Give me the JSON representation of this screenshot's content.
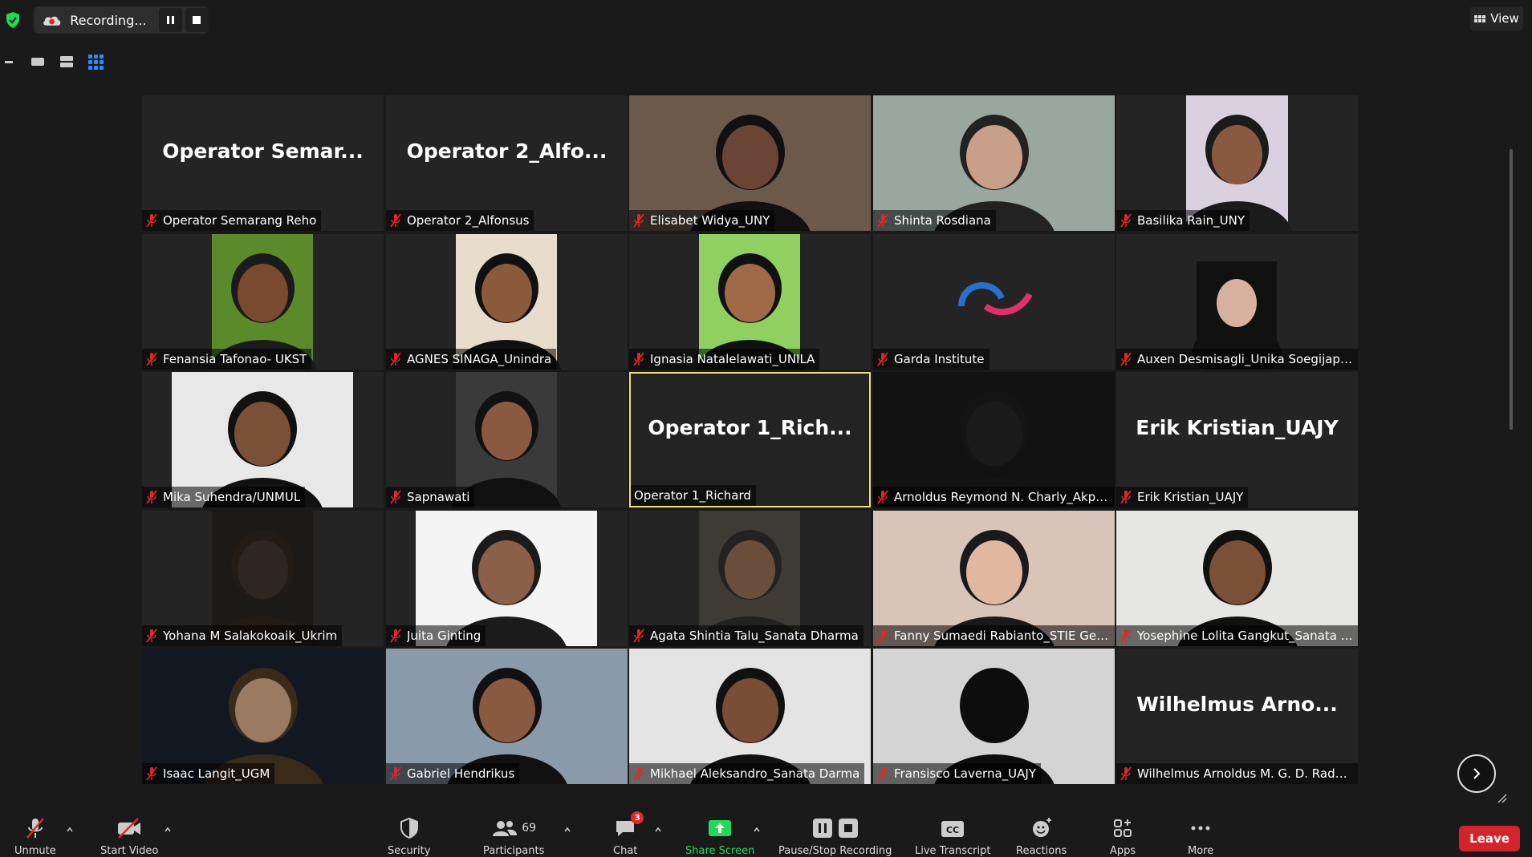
{
  "top": {
    "recording_label": "Recording...",
    "view_label": "View"
  },
  "participants_grid": [
    {
      "name": "Operator Semarang Reho",
      "big_name": "Operator  Semar...",
      "has_video": false,
      "muted": true
    },
    {
      "name": "Operator 2_Alfonsus",
      "big_name": "Operator  2_Alfo...",
      "has_video": false,
      "muted": true
    },
    {
      "name": "Elisabet Widya_UNY",
      "has_video": true,
      "muted": true
    },
    {
      "name": "Shinta Rosdiana",
      "has_video": true,
      "muted": true
    },
    {
      "name": "Basilika Rain_UNY",
      "has_video": true,
      "muted": true
    },
    {
      "name": "Fenansia Tafonao- UKST",
      "has_video": true,
      "muted": true
    },
    {
      "name": "AGNES SINAGA_Unindra",
      "has_video": true,
      "muted": true
    },
    {
      "name": "Ignasia Natalelawati_UNILA",
      "has_video": true,
      "muted": true
    },
    {
      "name": "Garda Institute",
      "has_video": true,
      "muted": true
    },
    {
      "name": "Auxen Desmisagli_Unika Soegijapran...",
      "has_video": true,
      "muted": true
    },
    {
      "name": "Mika Suhendra/UNMUL",
      "has_video": true,
      "muted": true
    },
    {
      "name": "Sapnawati",
      "has_video": true,
      "muted": true
    },
    {
      "name": "Operator 1_Richard",
      "big_name": "Operator  1_Rich...",
      "has_video": false,
      "muted": false,
      "active_speaker": true
    },
    {
      "name": "Arnoldus Reymond N. Charly_Akprind",
      "has_video": true,
      "muted": true
    },
    {
      "name": "Erik Kristian_UAJY",
      "big_name": "Erik Kristian_UAJY",
      "has_video": false,
      "muted": true
    },
    {
      "name": "Yohana M Salakokoaik_Ukrim",
      "has_video": true,
      "muted": true
    },
    {
      "name": "Juita Ginting",
      "has_video": true,
      "muted": true
    },
    {
      "name": "Agata Shintia Talu_Sanata Dharma",
      "has_video": true,
      "muted": true
    },
    {
      "name": "Fanny Sumaedi Rabianto_STIE Gentia...",
      "has_video": true,
      "muted": true
    },
    {
      "name": "Yosephine Lolita Gangkut_Sanata Dh...",
      "has_video": true,
      "muted": true
    },
    {
      "name": "Isaac Langit_UGM",
      "has_video": true,
      "muted": true
    },
    {
      "name": "Gabriel Hendrikus",
      "has_video": true,
      "muted": true
    },
    {
      "name": "Mikhael Aleksandro_Sanata Darma",
      "has_video": true,
      "muted": true
    },
    {
      "name": "Fransisco Laverna_UAJY",
      "has_video": true,
      "muted": true
    },
    {
      "name": "Wilhelmus Arnoldus M. G. D. Rada_U...",
      "big_name": "Wilhelmus  Arno...",
      "has_video": false,
      "muted": true
    }
  ],
  "toolbar": {
    "unmute": "Unmute",
    "start_video": "Start Video",
    "security": "Security",
    "participants": "Participants",
    "participants_count": "69",
    "chat": "Chat",
    "chat_badge": "3",
    "share_screen": "Share Screen",
    "pause_stop_recording": "Pause/Stop Recording",
    "live_transcript": "Live Transcript",
    "reactions": "Reactions",
    "apps": "Apps",
    "more": "More",
    "leave": "Leave"
  },
  "colors": {
    "background": "#1a1a1a",
    "tile": "#242424",
    "active_speaker_border": "#e8e27a",
    "muted_red": "#e02828",
    "leave_red": "#d3242b",
    "share_green": "#23d959",
    "gallery_blue": "#2d8cff"
  }
}
